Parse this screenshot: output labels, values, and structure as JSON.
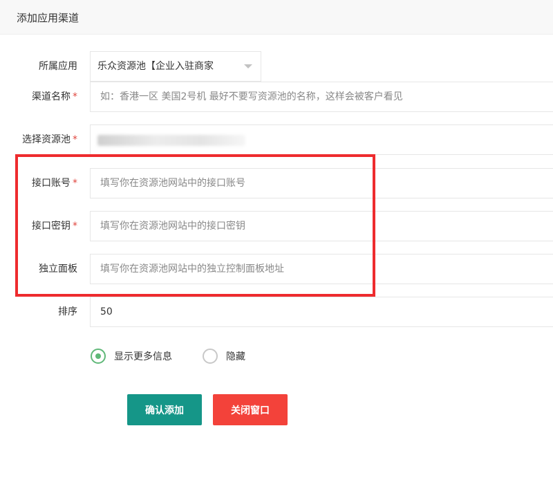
{
  "header": {
    "title": "添加应用渠道"
  },
  "form": {
    "app": {
      "label": "所属应用",
      "value": "乐众资源池【企业入驻商家"
    },
    "channel_name": {
      "label": "渠道名称",
      "required_mark": "*",
      "placeholder": "如：香港一区 美国2号机 最好不要写资源池的名称，这样会被客户看见"
    },
    "pool": {
      "label": "选择资源池",
      "required_mark": "*"
    },
    "api_account": {
      "label": "接口账号",
      "required_mark": "*",
      "placeholder": "填写你在资源池网站中的接口账号"
    },
    "api_secret": {
      "label": "接口密钥",
      "required_mark": "*",
      "placeholder": "填写你在资源池网站中的接口密钥"
    },
    "panel": {
      "label": "独立面板",
      "placeholder": "填写你在资源池网站中的独立控制面板地址"
    },
    "sort": {
      "label": "排序",
      "value": "50"
    },
    "visibility": {
      "options": [
        {
          "label": "显示更多信息",
          "checked": true
        },
        {
          "label": "隐藏",
          "checked": false
        }
      ]
    }
  },
  "buttons": {
    "confirm": "确认添加",
    "close": "关闭窗口"
  },
  "colors": {
    "primary": "#159688",
    "danger": "#f3423a",
    "highlight": "#ee2b2e",
    "radio_active": "#5fb878",
    "required": "#e0463e"
  }
}
